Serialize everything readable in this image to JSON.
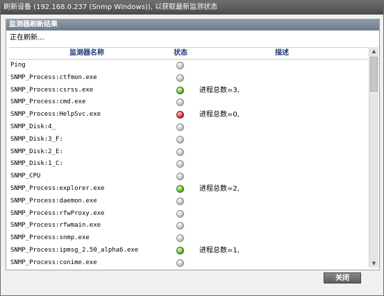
{
  "window": {
    "title": "刷新设备 (192.168.0.237 (Snmp Windows)), 以获取最新监测状态"
  },
  "panel": {
    "header": "监测器刷新结果",
    "status_text": "正在刷新..."
  },
  "table": {
    "columns": [
      "监测器名称",
      "状态",
      "描述"
    ],
    "rows": [
      {
        "name": "Ping",
        "status": "gray",
        "desc": ""
      },
      {
        "name": "SNMP_Process:ctfmon.exe",
        "status": "gray",
        "desc": ""
      },
      {
        "name": "SNMP_Process:csrss.exe",
        "status": "green",
        "desc": "进程总数=3,"
      },
      {
        "name": "SNMP_Process:cmd.exe",
        "status": "gray",
        "desc": ""
      },
      {
        "name": "SNMP_Process:HelpSvc.exe",
        "status": "red",
        "desc": "进程总数=0,"
      },
      {
        "name": "SNMP_Disk:4_",
        "status": "gray",
        "desc": ""
      },
      {
        "name": "SNMP_Disk:3_F:",
        "status": "gray",
        "desc": ""
      },
      {
        "name": "SNMP_Disk:2_E:",
        "status": "gray",
        "desc": ""
      },
      {
        "name": "SNMP_Disk:1_C:",
        "status": "gray",
        "desc": ""
      },
      {
        "name": "SNMP_CPU",
        "status": "gray",
        "desc": ""
      },
      {
        "name": "SNMP_Process:explorer.exe",
        "status": "green",
        "desc": "进程总数=2,"
      },
      {
        "name": "SNMP_Process:daemon.exe",
        "status": "gray",
        "desc": ""
      },
      {
        "name": "SNMP_Process:rfwProxy.exe",
        "status": "gray",
        "desc": ""
      },
      {
        "name": "SNMP_Process:rfwmain.exe",
        "status": "gray",
        "desc": ""
      },
      {
        "name": "SNMP_Process:snmp.exe",
        "status": "gray",
        "desc": ""
      },
      {
        "name": "SNMP_Process:ipmsg_2.50_alpha6.exe",
        "status": "green",
        "desc": "进程总数=1,"
      },
      {
        "name": "SNMP_Process:conime.exe",
        "status": "gray",
        "desc": ""
      }
    ]
  },
  "scrollbar": {
    "up_icon": "arrow-up-icon",
    "down_icon": "arrow-down-icon"
  },
  "buttons": {
    "close": "关闭"
  },
  "colors": {
    "status_ok": "#66c33a",
    "status_error": "#e03a3a",
    "status_unknown": "#c8c8c8"
  }
}
